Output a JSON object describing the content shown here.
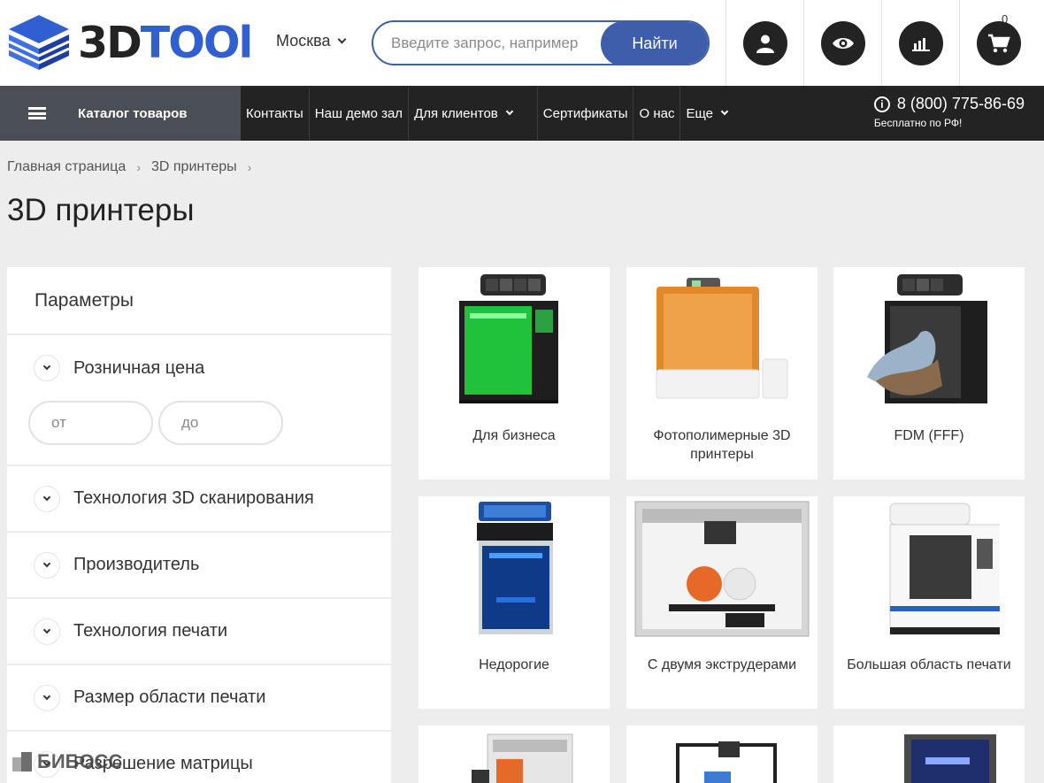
{
  "header": {
    "logo_text_dark": "3D",
    "logo_text_blue": "TOOl",
    "city": "Москва",
    "search_placeholder": "Введите запрос, например",
    "search_button": "Найти",
    "cart_count": "0",
    "icons": [
      "user-icon",
      "eye-icon",
      "compare-icon",
      "cart-icon"
    ]
  },
  "nav": {
    "catalog": "Каталог товаров",
    "items": [
      "Контакты",
      "Наш демо зал",
      "Для клиентов",
      "Сертификаты",
      "О нас",
      "Еще"
    ],
    "phone": "8 (800) 775-86-69",
    "phone_note": "Бесплатно по РФ!"
  },
  "breadcrumbs": [
    "Главная страница",
    "3D принтеры"
  ],
  "page_title": "3D принтеры",
  "filters": {
    "title": "Параметры",
    "price_label": "Розничная цена",
    "price_from_placeholder": "от",
    "price_to_placeholder": "до",
    "groups": [
      "Технология 3D сканирования",
      "Производитель",
      "Технология печати",
      "Размер области печати",
      "Разрешение матрицы"
    ]
  },
  "categories": [
    {
      "name": "Для бизнеса"
    },
    {
      "name": "Фотополимерные 3D принтеры"
    },
    {
      "name": "FDM (FFF)"
    },
    {
      "name": "Недорогие"
    },
    {
      "name": "С двумя экструдерами"
    },
    {
      "name": "Большая область печати"
    }
  ],
  "watermark": "БИБОСС",
  "colors": {
    "brand_blue": "#2f5fd0",
    "button_blue": "#3e5eab",
    "nav_dark": "#232323",
    "catalog_bg": "#4a4e55"
  }
}
